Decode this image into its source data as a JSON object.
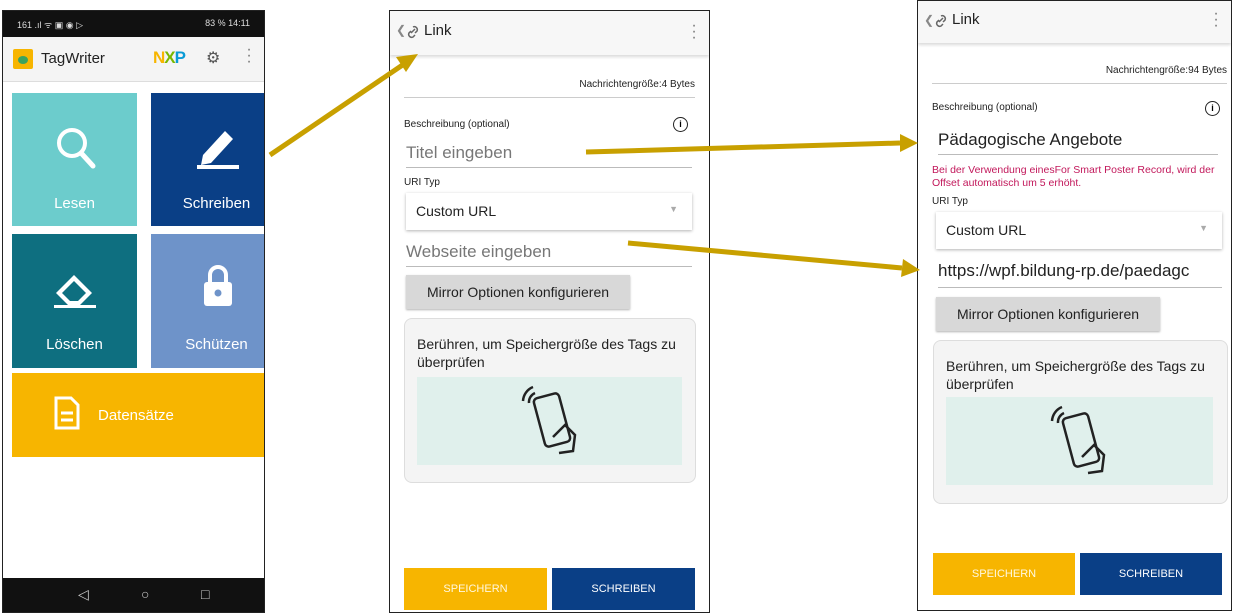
{
  "phone1": {
    "status_left": "161 .ıl ᯤ ▣ ◉ ▷",
    "status_right": "83 % 14:11",
    "app_title": "TagWriter",
    "brand_logo": "NXP",
    "tiles": [
      {
        "label": "Lesen",
        "color": "#6ccccc",
        "icon": "search-icon"
      },
      {
        "label": "Schreiben",
        "color": "#0a3f86",
        "icon": "pencil-icon"
      },
      {
        "label": "Löschen",
        "color": "#0e6f80",
        "icon": "eraser-icon"
      },
      {
        "label": "Schützen",
        "color": "#6e93c9",
        "icon": "lock-icon"
      },
      {
        "label": "Datensätze",
        "color": "#f7b500",
        "icon": "document-icon"
      }
    ]
  },
  "phone2": {
    "title": "Link",
    "msg_size": "Nachrichtengröße:4 Bytes",
    "desc_label": "Beschreibung (optional)",
    "title_placeholder": "Titel eingeben",
    "uri_label": "URI Typ",
    "uri_value": "Custom URL",
    "website_placeholder": "Webseite eingeben",
    "mirror_button": "Mirror Optionen konfigurieren",
    "card_text": "Berühren, um Speichergröße des Tags zu überprüfen",
    "save_button": "SPEICHERN",
    "write_button": "SCHREIBEN"
  },
  "phone3": {
    "title": "Link",
    "msg_size": "Nachrichtengröße:94 Bytes",
    "desc_label": "Beschreibung (optional)",
    "title_value": "Pädagogische Angebote",
    "warning": "Bei der Verwendung einesFor Smart Poster Record, wird der Offset automatisch um 5 erhöht.",
    "uri_label": "URI Typ",
    "uri_value": "Custom URL",
    "website_value": "https://wpf.bildung-rp.de/paedagc",
    "mirror_button": "Mirror Optionen konfigurieren",
    "card_text": "Berühren, um Speichergröße des Tags zu überprüfen",
    "save_button": "SPEICHERN",
    "write_button": "SCHREIBEN"
  },
  "colors": {
    "arrow": "#c8a000",
    "accent_yellow": "#f7b500",
    "accent_blue": "#0a3f86",
    "warning": "#c2185b"
  }
}
